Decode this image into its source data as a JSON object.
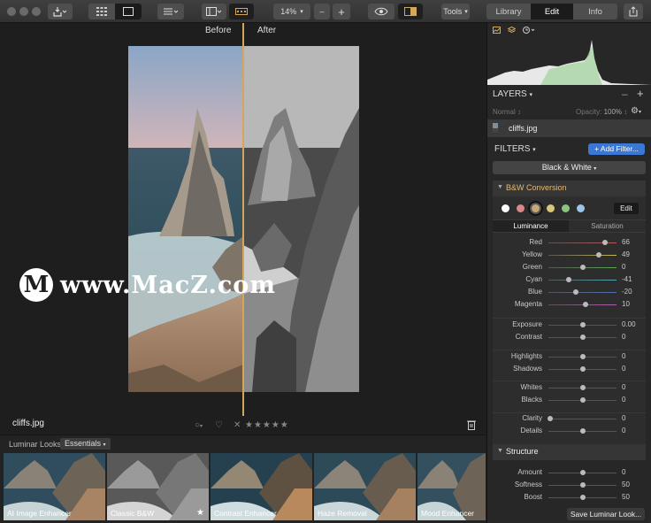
{
  "toolbar": {
    "zoom": "14%",
    "zoom_minus": "–",
    "zoom_plus": "+",
    "tools": "Tools",
    "tabs": [
      "Library",
      "Edit",
      "Info"
    ]
  },
  "canvas": {
    "before": "Before",
    "after": "After",
    "filename": "cliffs.jpg"
  },
  "watermark": {
    "text": "www.MacZ.com"
  },
  "looks": {
    "label": "Luminar Looks:",
    "category": "Essentials",
    "items": [
      "AI Image Enhancer",
      "Classic B&W",
      "Contrast Enhancer",
      "Haze Removal",
      "Mood Enhancer"
    ]
  },
  "panel": {
    "layers_title": "LAYERS",
    "blend_mode": "Normal",
    "opacity_label": "Opacity:",
    "opacity_value": "100%",
    "layer_name": "cliffs.jpg",
    "filters_title": "FILTERS",
    "add_filter": "+ Add Filter...",
    "preset": "Black & White",
    "bw_title": "B&W Conversion",
    "edit_button": "Edit",
    "subtabs": [
      "Luminance",
      "Saturation"
    ],
    "swatch_colors": [
      "#ffffff",
      "#d7898a",
      "#c6a873",
      "#d9c77b",
      "#8cc37f",
      "#9cc5e6"
    ],
    "luminance": [
      {
        "label": "Red",
        "value": "66",
        "pos": 0.83,
        "color": "#b9585a"
      },
      {
        "label": "Yellow",
        "value": "49",
        "pos": 0.745,
        "color": "#c8b85c"
      },
      {
        "label": "Green",
        "value": "0",
        "pos": 0.5,
        "color": "#5fa45f"
      },
      {
        "label": "Cyan",
        "value": "-41",
        "pos": 0.295,
        "color": "#55a9b7"
      },
      {
        "label": "Blue",
        "value": "-20",
        "pos": 0.4,
        "color": "#5571b5"
      },
      {
        "label": "Magenta",
        "value": "10",
        "pos": 0.55,
        "color": "#b25fb0"
      }
    ],
    "basic": [
      {
        "label": "Exposure",
        "value": "0.00",
        "pos": 0.5
      },
      {
        "label": "Contrast",
        "value": "0",
        "pos": 0.5
      },
      {
        "label": "Highlights",
        "value": "0",
        "pos": 0.5
      },
      {
        "label": "Shadows",
        "value": "0",
        "pos": 0.5
      },
      {
        "label": "Whites",
        "value": "0",
        "pos": 0.5
      },
      {
        "label": "Blacks",
        "value": "0",
        "pos": 0.5
      },
      {
        "label": "Clarity",
        "value": "0",
        "pos": 0.02
      },
      {
        "label": "Details",
        "value": "0",
        "pos": 0.5
      }
    ],
    "structure_title": "Structure",
    "structure": [
      {
        "label": "Amount",
        "value": "0",
        "pos": 0.5
      },
      {
        "label": "Softness",
        "value": "50",
        "pos": 0.5
      },
      {
        "label": "Boost",
        "value": "50",
        "pos": 0.5
      }
    ],
    "save_looks": "Save Luminar Look..."
  }
}
